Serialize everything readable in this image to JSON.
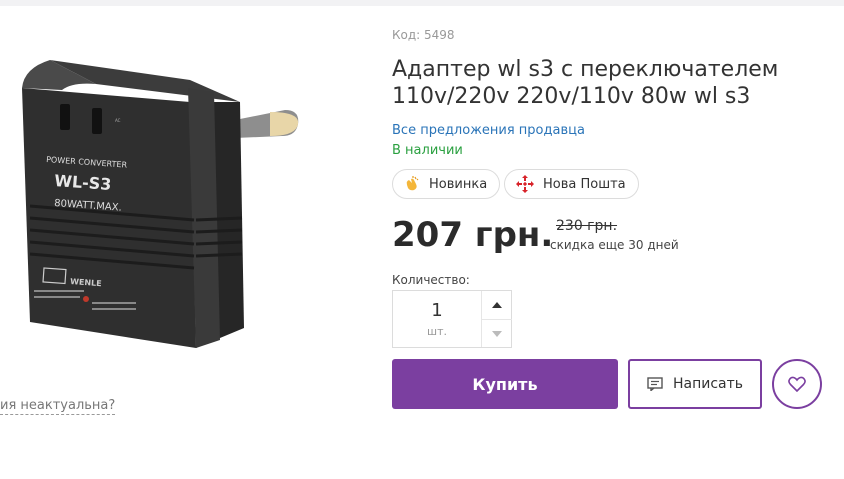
{
  "product": {
    "sku": "Код: 5498",
    "title": "Адаптер wl s3 с переключателем 110v/220v 220v/110v 80w wl s3",
    "image_text": {
      "line1": "POWER CONVERTER",
      "line2": "WL-S3",
      "line3": "80WATT.MAX.",
      "brand": "WENLE"
    },
    "seller_link": "Все предложения продавца",
    "availability": "В наличии",
    "report_link": "ия неактуальна?"
  },
  "badges": {
    "new": {
      "label": "Новинка",
      "icon": "hand-clap-icon"
    },
    "shipping": {
      "label": "Нова Пошта",
      "icon": "nova-poshta-icon"
    }
  },
  "pricing": {
    "price": "207 грн.",
    "old_price": "230 грн.",
    "discount_note": "скидка еще 30 дней"
  },
  "quantity": {
    "label": "Количество:",
    "value": "1",
    "unit": "шт."
  },
  "actions": {
    "buy_label": "Купить",
    "write_label": "Написать",
    "wishlist_icon": "heart-icon"
  },
  "colors": {
    "accent": "#7b3fa0",
    "link": "#2a74b8",
    "in_stock": "#2aa040",
    "nova_poshta": "#d8232a"
  }
}
